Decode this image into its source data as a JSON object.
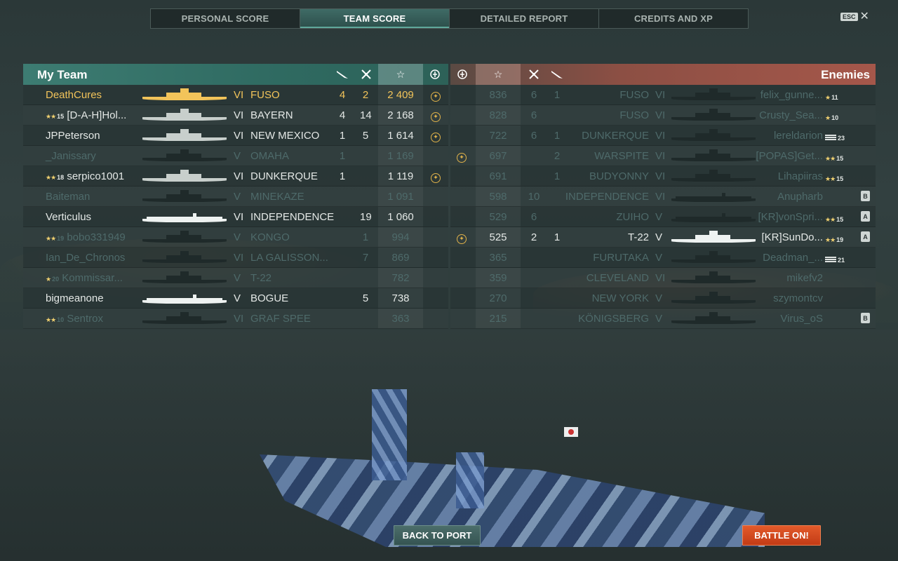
{
  "tabs": [
    {
      "label": "PERSONAL SCORE",
      "active": false
    },
    {
      "label": "TEAM SCORE",
      "active": true
    },
    {
      "label": "DETAILED REPORT",
      "active": false
    },
    {
      "label": "CREDITS AND XP",
      "active": false
    }
  ],
  "esc_label": "ESC",
  "close_glyph": "✕",
  "my_team": {
    "title": "My Team",
    "header_icons": [
      "torpedo-icon",
      "kills-icon",
      "star-icon",
      "capture-icon"
    ],
    "rows": [
      {
        "name": "DeathCures",
        "rank_stars": "",
        "rank_num": "",
        "tier": "VI",
        "ship": "FUSO",
        "torp": "4",
        "kills": "2",
        "score": "2 409",
        "cap": true,
        "state": "self"
      },
      {
        "name": "[D-A-H]Hol...",
        "rank_stars": "★★",
        "rank_num": "15",
        "tier": "VI",
        "ship": "BAYERN",
        "torp": "4",
        "kills": "14",
        "score": "2 168",
        "cap": true,
        "state": "alive"
      },
      {
        "name": "JPPeterson",
        "rank_stars": "",
        "rank_num": "",
        "tier": "VI",
        "ship": "NEW MEXICO",
        "torp": "1",
        "kills": "5",
        "score": "1 614",
        "cap": true,
        "state": "alive"
      },
      {
        "name": "_Janissary",
        "rank_stars": "",
        "rank_num": "",
        "tier": "V",
        "ship": "OMAHA",
        "torp": "1",
        "kills": "",
        "score": "1 169",
        "cap": false,
        "state": "dead"
      },
      {
        "name": "serpico1001",
        "rank_stars": "★★",
        "rank_num": "18",
        "tier": "VI",
        "ship": "DUNKERQUE",
        "torp": "1",
        "kills": "",
        "score": "1 119",
        "cap": true,
        "state": "alive"
      },
      {
        "name": "Baiteman",
        "rank_stars": "",
        "rank_num": "",
        "tier": "V",
        "ship": "MINEKAZE",
        "torp": "",
        "kills": "",
        "score": "1 091",
        "cap": false,
        "state": "dead"
      },
      {
        "name": "Verticulus",
        "rank_stars": "",
        "rank_num": "",
        "tier": "VI",
        "ship": "INDEPENDENCE",
        "torp": "",
        "kills": "19",
        "score": "1 060",
        "cap": false,
        "state": "alive",
        "carrier": true
      },
      {
        "name": "bobo331949",
        "rank_stars": "★★",
        "rank_num": "19",
        "tier": "V",
        "ship": "KONGO",
        "torp": "",
        "kills": "1",
        "score": "994",
        "cap": false,
        "state": "dead"
      },
      {
        "name": "Ian_De_Chronos",
        "rank_stars": "",
        "rank_num": "",
        "tier": "VI",
        "ship": "LA GALISSON...",
        "torp": "",
        "kills": "7",
        "score": "869",
        "cap": false,
        "state": "dead"
      },
      {
        "name": "Kommissar...",
        "rank_stars": "★",
        "rank_num": "20",
        "tier": "V",
        "ship": "T-22",
        "torp": "",
        "kills": "",
        "score": "782",
        "cap": false,
        "state": "dead"
      },
      {
        "name": "bigmeanone",
        "rank_stars": "",
        "rank_num": "",
        "tier": "V",
        "ship": "BOGUE",
        "torp": "",
        "kills": "5",
        "score": "738",
        "cap": false,
        "state": "alive",
        "carrier": true
      },
      {
        "name": "Sentrox",
        "rank_stars": "★★",
        "rank_num": "10",
        "tier": "VI",
        "ship": "GRAF SPEE",
        "torp": "",
        "kills": "",
        "score": "363",
        "cap": false,
        "state": "dead"
      }
    ]
  },
  "enemies": {
    "title": "Enemies",
    "header_icons": [
      "capture-icon",
      "star-icon",
      "kills-icon",
      "torpedo-icon"
    ],
    "rows": [
      {
        "cap": false,
        "score": "836",
        "kills": "6",
        "torp": "1",
        "ship": "FUSO",
        "tier": "VI",
        "name": "felix_gunne...",
        "rank_stars": "★",
        "rank_num": "11",
        "badge": "",
        "state": "dead"
      },
      {
        "cap": false,
        "score": "828",
        "kills": "6",
        "torp": "",
        "ship": "FUSO",
        "tier": "VI",
        "name": "Crusty_Sea...",
        "rank_stars": "★",
        "rank_num": "10",
        "badge": "",
        "state": "dead"
      },
      {
        "cap": false,
        "score": "722",
        "kills": "6",
        "torp": "1",
        "ship": "DUNKERQUE",
        "tier": "VI",
        "name": "lereldarion",
        "rank_stars": "",
        "rank_num": "23",
        "badge": "",
        "state": "dead",
        "flag": true
      },
      {
        "cap": true,
        "score": "697",
        "kills": "",
        "torp": "2",
        "ship": "WARSPITE",
        "tier": "VI",
        "name": "[POPAS]Get...",
        "rank_stars": "★★",
        "rank_num": "15",
        "badge": "",
        "state": "dead"
      },
      {
        "cap": false,
        "score": "691",
        "kills": "",
        "torp": "1",
        "ship": "BUDYONNY",
        "tier": "VI",
        "name": "Lihapiiras",
        "rank_stars": "★★",
        "rank_num": "15",
        "badge": "",
        "state": "dead"
      },
      {
        "cap": false,
        "score": "598",
        "kills": "10",
        "torp": "",
        "ship": "INDEPENDENCE",
        "tier": "VI",
        "name": "Anupharb",
        "rank_stars": "",
        "rank_num": "",
        "badge": "B",
        "state": "dead",
        "carrier": true
      },
      {
        "cap": false,
        "score": "529",
        "kills": "6",
        "torp": "",
        "ship": "ZUIHO",
        "tier": "V",
        "name": "[KR]vonSpri...",
        "rank_stars": "★★",
        "rank_num": "15",
        "badge": "A",
        "state": "dead",
        "carrier": true
      },
      {
        "cap": true,
        "score": "525",
        "kills": "2",
        "torp": "1",
        "ship": "T-22",
        "tier": "V",
        "name": "[KR]SunDo...",
        "rank_stars": "★★",
        "rank_num": "19",
        "badge": "A",
        "state": "alive"
      },
      {
        "cap": false,
        "score": "365",
        "kills": "",
        "torp": "",
        "ship": "FURUTAKA",
        "tier": "V",
        "name": "Deadman_...",
        "rank_stars": "",
        "rank_num": "21",
        "badge": "",
        "state": "dead",
        "flag": true
      },
      {
        "cap": false,
        "score": "359",
        "kills": "",
        "torp": "",
        "ship": "CLEVELAND",
        "tier": "VI",
        "name": "mikefv2",
        "rank_stars": "",
        "rank_num": "",
        "badge": "",
        "state": "dead"
      },
      {
        "cap": false,
        "score": "270",
        "kills": "",
        "torp": "",
        "ship": "NEW YORK",
        "tier": "V",
        "name": "szymontcv",
        "rank_stars": "",
        "rank_num": "",
        "badge": "",
        "state": "dead"
      },
      {
        "cap": false,
        "score": "215",
        "kills": "",
        "torp": "",
        "ship": "KÖNIGSBERG",
        "tier": "V",
        "name": "Virus_oS",
        "rank_stars": "",
        "rank_num": "",
        "badge": "B",
        "state": "dead"
      }
    ]
  },
  "buttons": {
    "back_to_port": "BACK TO PORT",
    "battle_on": "BATTLE ON!"
  }
}
